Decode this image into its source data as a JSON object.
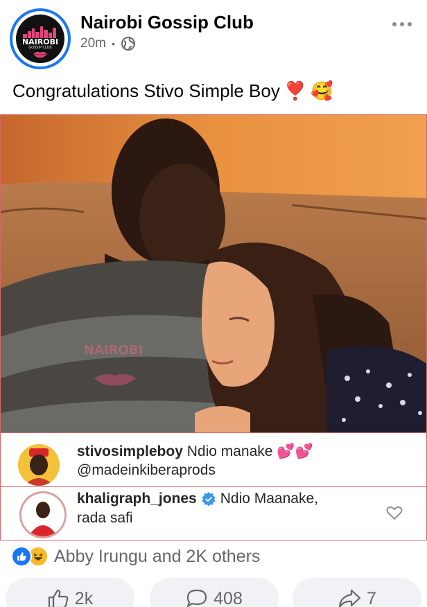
{
  "post": {
    "page_name": "Nairobi Gossip Club",
    "time": "20m",
    "privacy_icon": "globe-icon",
    "text": "Congratulations Stivo Simple Boy",
    "emojis": [
      "❣️",
      "🥰"
    ],
    "avatar_logo_text": "NAIROBI",
    "avatar_logo_subtext": "GOSSIP CLUB"
  },
  "photo": {
    "watermark": "NAIROBI"
  },
  "comments": [
    {
      "user": "stivosimpleboy",
      "text": "Ndio manake",
      "emoji": "💕💕",
      "line2": "@madeinkiberaprods",
      "verified": false
    },
    {
      "user": "khaligraph_jones",
      "text": "Ndio Maanake,",
      "line2": "rada safi",
      "verified": true
    }
  ],
  "reactions": {
    "summary": "Abby Irungu and 2K others",
    "icons": [
      "like-icon",
      "haha-icon"
    ]
  },
  "actions": {
    "like_count": "2k",
    "comment_count": "408",
    "share_count": "7"
  },
  "colors": {
    "brand_blue": "#1877f2",
    "secondary_text": "#65676b",
    "button_bg": "#f0f2f5"
  }
}
